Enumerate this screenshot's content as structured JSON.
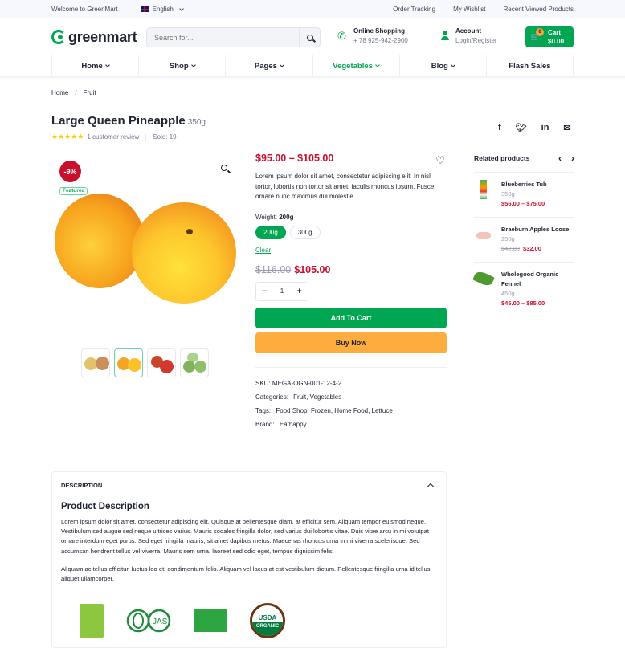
{
  "topbar": {
    "welcome": "Welcome to GreenMart",
    "language": "English",
    "links": [
      "Order Tracking",
      "My Wishlist",
      "Recent Viewed Products"
    ]
  },
  "header": {
    "logo": "greenmart",
    "search_placeholder": "Search for...",
    "phone_label": "Online Shopping",
    "phone_number": "+ 78 925-942-2900",
    "account_label": "Account",
    "account_sub": "Login/Register",
    "cart_label": "Cart",
    "cart_total": "$0.00",
    "cart_count": "0"
  },
  "nav": [
    {
      "label": "Home",
      "dropdown": true
    },
    {
      "label": "Shop",
      "dropdown": true
    },
    {
      "label": "Pages",
      "dropdown": true
    },
    {
      "label": "Vegetables",
      "dropdown": true,
      "active": true
    },
    {
      "label": "Blog",
      "dropdown": true
    },
    {
      "label": "Flash Sales",
      "dropdown": false
    }
  ],
  "breadcrumb": [
    "Home",
    "Fruit"
  ],
  "product": {
    "title": "Large Queen Pineapple",
    "weight": "350g",
    "stars": "★★★★★",
    "reviews": "1 customer review",
    "sold": "Sold: 19",
    "discount": "-9%",
    "featured": "Featured",
    "price_range": "$95.00 – $105.00",
    "short_desc": "Lorem ipsum dolor sit amet, consectetur adipiscing elit. In nisl tortor, lobortis non tortor sit amet, iaculis rhoncus ipsum. Fusce ornare nunc maximus dui molestie.",
    "weight_label": "Weight:",
    "weight_selected": "200g",
    "weight_options": [
      "200g",
      "300g"
    ],
    "clear": "Clear",
    "old_price": "$116.00",
    "new_price": "$105.00",
    "quantity": "1",
    "add_to_cart": "Add To Cart",
    "buy_now": "Buy Now",
    "sku_label": "SKU:",
    "sku": "MEGA-OGN-001-12-4-2",
    "categories_label": "Categories:",
    "categories": "Fruit, Vegetables",
    "tags_label": "Tags:",
    "tags": "Food Shop, Frozen, Home Food, Lettuce",
    "brand_label": "Brand:",
    "brand": "Eathappy"
  },
  "share": [
    "facebook",
    "twitter",
    "linkedin",
    "email"
  ],
  "related": {
    "title": "Related products",
    "items": [
      {
        "name": "Blueberries Tub",
        "weight": "350g",
        "price": "$56.00 – $75.00",
        "old": ""
      },
      {
        "name": "Braeburn Apples Loose",
        "weight": "250g",
        "price": "$32.00",
        "old": "$42.00"
      },
      {
        "name": "Wholegood Organic Fennel",
        "weight": "450g",
        "price": "$45.00 – $85.00",
        "old": ""
      }
    ]
  },
  "description": {
    "tab": "DESCRIPTION",
    "title": "Product Description",
    "p1": "Lorem ipsum dolor sit amet, consectetur adipiscing elit. Quisque at pellentesque diam, at efficitur sem. Aliquam tempor euismod neque. Vestibulum sed augue sed neque ultrices varius. Mauris sodales fringilla dolor, sed varius dui lobortis vitae. Duis vitae arcu in mi volutpat ornare interdum eget purus. Sed eget fringilla mauris, sit amet dapibus metus. Maecenas rhoncus urna in mi viverra scelerisque. Sed accumsan hendrerit tellus vel viverra. Mauris sem urna, laoreet sed odio eget, tempus dignissim felis.",
    "p2": "Aliquam ac tellus efficitur, luctus leo et, condimentum felis. Aliquam vel lacus at est vestibulum dictum. Pellentesque fringilla urna id tellus aliquet ullamcorper.",
    "cert_jas": "JAS",
    "cert_usda": "USDA",
    "cert_organic": "ORGANIC"
  },
  "colors": {
    "brand": "#00a651",
    "price": "#c8102e",
    "buy": "#fdad3e",
    "star": "#ffcd00"
  }
}
